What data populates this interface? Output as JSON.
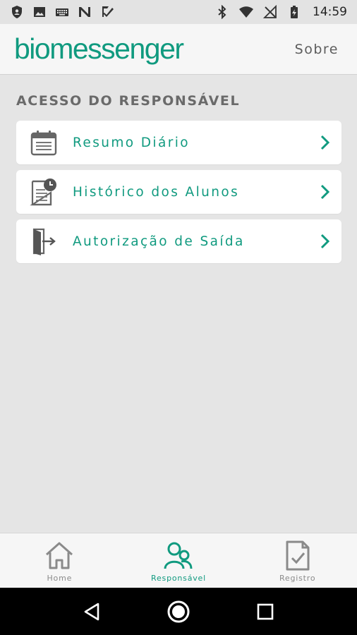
{
  "status_bar": {
    "time": "14:59",
    "left_icons": [
      "shield-icon",
      "image-icon",
      "keyboard-icon",
      "n-icon",
      "check-icon"
    ],
    "right_icons": [
      "bluetooth-icon",
      "wifi-icon",
      "no-signal-icon",
      "battery-charging-icon"
    ]
  },
  "app_bar": {
    "logo": "biomessenger",
    "about_label": "Sobre"
  },
  "main": {
    "section_title": "ACESSO DO RESPONSÁVEL",
    "items": [
      {
        "label": "Resumo Diário",
        "icon": "calendar-icon"
      },
      {
        "label": "Histórico dos Alunos",
        "icon": "history-document-icon"
      },
      {
        "label": "Autorização de Saída",
        "icon": "exit-door-icon"
      }
    ]
  },
  "bottom_nav": {
    "items": [
      {
        "label": "Home",
        "icon": "home-icon",
        "active": false
      },
      {
        "label": "Responsável",
        "icon": "users-icon",
        "active": true
      },
      {
        "label": "Registro",
        "icon": "document-check-icon",
        "active": false
      }
    ]
  },
  "colors": {
    "accent": "#109a7f",
    "background": "#e5e5e5",
    "card": "#ffffff",
    "section_title": "#6a6a6a",
    "inactive": "#8a8a8a"
  },
  "system_nav": [
    "back-icon",
    "home-circle-icon",
    "recents-icon"
  ]
}
